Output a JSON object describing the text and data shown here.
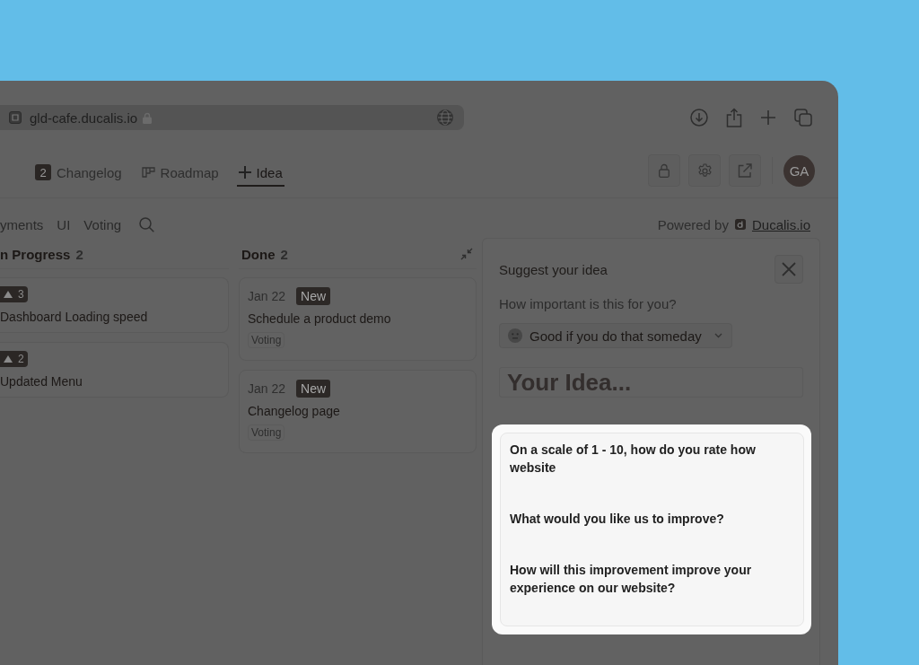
{
  "browser": {
    "url": "gld-cafe.ducalis.io"
  },
  "nav": {
    "tabs": [
      {
        "kind": "counter",
        "badge": "2",
        "label": "Changelog",
        "selected": false
      },
      {
        "kind": "roadmap",
        "label": "Roadmap",
        "selected": false
      },
      {
        "kind": "add",
        "label": "Idea",
        "selected": true
      }
    ],
    "avatar": "GA"
  },
  "filters": [
    "yments",
    "UI",
    "Voting"
  ],
  "powered_by": {
    "label": "Powered by",
    "link": "Ducalis.io"
  },
  "columns": [
    {
      "title": "n Progress",
      "count": "2",
      "collapsible": false,
      "cards": [
        {
          "kind": "vote",
          "votes": "3",
          "title": "Dashboard Loading speed"
        },
        {
          "kind": "vote",
          "votes": "2",
          "title": "Updated Menu"
        }
      ]
    },
    {
      "title": "Done",
      "count": "2",
      "collapsible": true,
      "cards": [
        {
          "kind": "release",
          "date": "Jan 22",
          "badge": "New",
          "title": "Schedule a product demo",
          "tag": "Voting"
        },
        {
          "kind": "release",
          "date": "Jan 22",
          "badge": "New",
          "title": "Changelog page",
          "tag": "Voting"
        }
      ]
    }
  ],
  "panel": {
    "title": "Suggest your idea",
    "question": "How important is this for you?",
    "importance": "Good if you do that someday",
    "idea_placeholder": "Your Idea...",
    "description": [
      "On a scale of 1 - 10, how do you rate how website",
      "What would you like us to improve?",
      "How will this improvement improve your experience on our website?"
    ]
  }
}
